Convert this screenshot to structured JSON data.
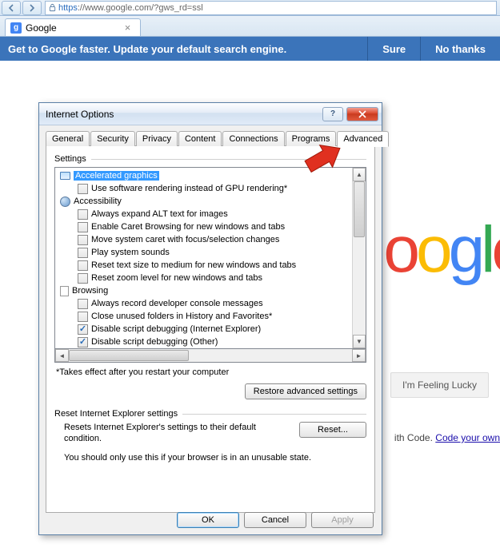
{
  "browser": {
    "url_https": "https",
    "url_rest": "://www.google.com/?gws_rd=ssl",
    "tab_title": "Google",
    "infobar_text": "Get to Google faster. Update your default search engine.",
    "infobar_sure": "Sure",
    "infobar_no": "No thanks"
  },
  "google": {
    "lucky": "I'm Feeling Lucky",
    "code_prefix": "ith Code. ",
    "code_link": "Code your own"
  },
  "dialog": {
    "title": "Internet Options",
    "tabs": [
      "General",
      "Security",
      "Privacy",
      "Content",
      "Connections",
      "Programs",
      "Advanced"
    ],
    "active_tab_index": 6,
    "settings_label": "Settings",
    "tree": [
      {
        "type": "cat",
        "icon": "monitor",
        "label": "Accelerated graphics",
        "selected": true
      },
      {
        "type": "item",
        "checked": false,
        "label": "Use software rendering instead of GPU rendering*"
      },
      {
        "type": "cat",
        "icon": "globe",
        "label": "Accessibility"
      },
      {
        "type": "item",
        "checked": false,
        "label": "Always expand ALT text for images"
      },
      {
        "type": "item",
        "checked": false,
        "label": "Enable Caret Browsing for new windows and tabs"
      },
      {
        "type": "item",
        "checked": false,
        "label": "Move system caret with focus/selection changes"
      },
      {
        "type": "item",
        "checked": false,
        "label": "Play system sounds"
      },
      {
        "type": "item",
        "checked": false,
        "label": "Reset text size to medium for new windows and tabs"
      },
      {
        "type": "item",
        "checked": false,
        "label": "Reset zoom level for new windows and tabs"
      },
      {
        "type": "cat",
        "icon": "page",
        "label": "Browsing"
      },
      {
        "type": "item",
        "checked": false,
        "label": "Always record developer console messages"
      },
      {
        "type": "item",
        "checked": false,
        "label": "Close unused folders in History and Favorites*"
      },
      {
        "type": "item",
        "checked": true,
        "label": "Disable script debugging (Internet Explorer)"
      },
      {
        "type": "item",
        "checked": true,
        "label": "Disable script debugging (Other)"
      }
    ],
    "restart_note": "*Takes effect after you restart your computer",
    "restore_btn": "Restore advanced settings",
    "reset_label": "Reset Internet Explorer settings",
    "reset_text": "Resets Internet Explorer's settings to their default condition.",
    "reset_btn": "Reset...",
    "reset_warn": "You should only use this if your browser is in an unusable state.",
    "ok": "OK",
    "cancel": "Cancel",
    "apply": "Apply"
  }
}
